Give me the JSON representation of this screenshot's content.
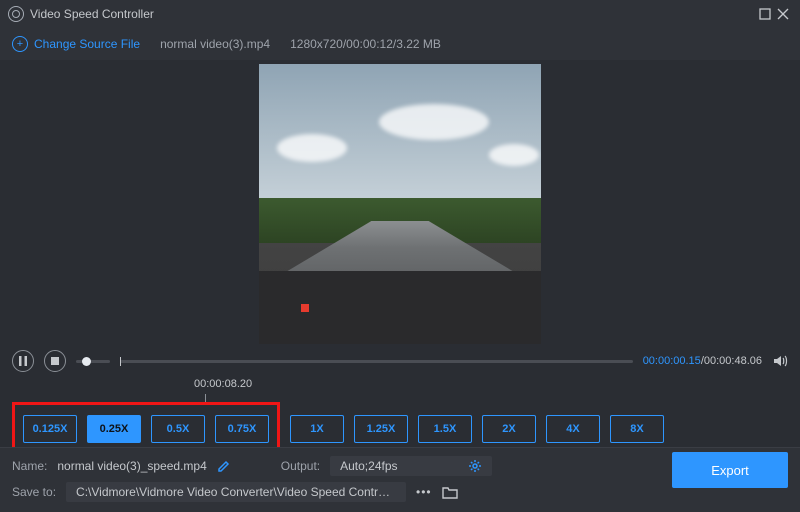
{
  "window": {
    "title": "Video Speed Controller"
  },
  "toolbar": {
    "change_label": "Change Source File",
    "filename": "normal video(3).mp4",
    "info": "1280x720/00:00:12/3.22 MB"
  },
  "player": {
    "tick_time": "00:00:08.20",
    "current_time": "00:00:00.15",
    "total_time": "00:00:48.06"
  },
  "speeds": {
    "options": [
      "0.125X",
      "0.25X",
      "0.5X",
      "0.75X",
      "1X",
      "1.25X",
      "1.5X",
      "2X",
      "4X",
      "8X"
    ],
    "selected_index": 1,
    "highlight_end_index": 3
  },
  "output": {
    "name_label": "Name:",
    "name_value": "normal video(3)_speed.mp4",
    "output_label": "Output:",
    "output_value": "Auto;24fps",
    "save_label": "Save to:",
    "save_path": "C:\\Vidmore\\Vidmore Video Converter\\Video Speed Controller",
    "export_label": "Export"
  }
}
